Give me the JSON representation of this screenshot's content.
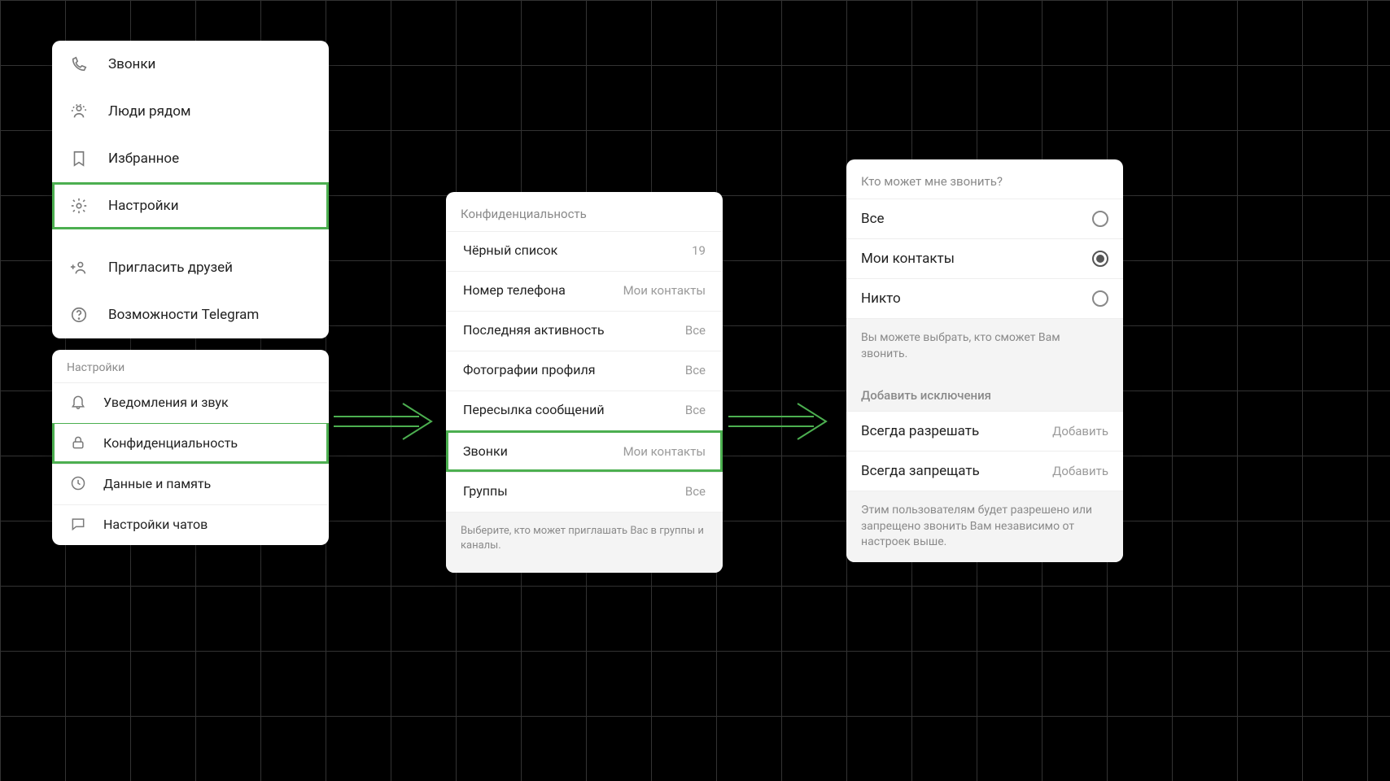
{
  "menu": {
    "items": [
      {
        "label": "Звонки",
        "icon": "phone"
      },
      {
        "label": "Люди рядом",
        "icon": "people-nearby"
      },
      {
        "label": "Избранное",
        "icon": "bookmark"
      },
      {
        "label": "Настройки",
        "icon": "gear",
        "highlight": true
      },
      {
        "label": "Пригласить друзей",
        "icon": "invite"
      },
      {
        "label": "Возможности Telegram",
        "icon": "help"
      }
    ]
  },
  "settings": {
    "header": "Настройки",
    "items": [
      {
        "label": "Уведомления и звук",
        "icon": "bell"
      },
      {
        "label": "Конфиденциальность",
        "icon": "lock",
        "highlight": true
      },
      {
        "label": "Данные и память",
        "icon": "clock"
      },
      {
        "label": "Настройки чатов",
        "icon": "chat"
      }
    ]
  },
  "privacy": {
    "header": "Конфиденциальность",
    "items": [
      {
        "label": "Чёрный список",
        "value": "19"
      },
      {
        "label": "Номер телефона",
        "value": "Мои контакты"
      },
      {
        "label": "Последняя активность",
        "value": "Все"
      },
      {
        "label": "Фотографии профиля",
        "value": "Все"
      },
      {
        "label": "Пересылка сообщений",
        "value": "Все"
      },
      {
        "label": "Звонки",
        "value": "Мои контакты",
        "highlight": true
      },
      {
        "label": "Группы",
        "value": "Все"
      }
    ],
    "footer": "Выберите, кто может приглашать Вас в группы и каналы."
  },
  "calls": {
    "header": "Кто может мне звонить?",
    "options": [
      {
        "label": "Все",
        "selected": false
      },
      {
        "label": "Мои контакты",
        "selected": true
      },
      {
        "label": "Никто",
        "selected": false
      }
    ],
    "note": "Вы можете выбрать, кто сможет Вам звонить.",
    "exceptions_header": "Добавить исключения",
    "exceptions": [
      {
        "label": "Всегда разрешать",
        "action": "Добавить"
      },
      {
        "label": "Всегда запрещать",
        "action": "Добавить"
      }
    ],
    "exceptions_note": "Этим пользователям будет разрешено или запрещено звонить Вам независимо от настроек выше."
  }
}
